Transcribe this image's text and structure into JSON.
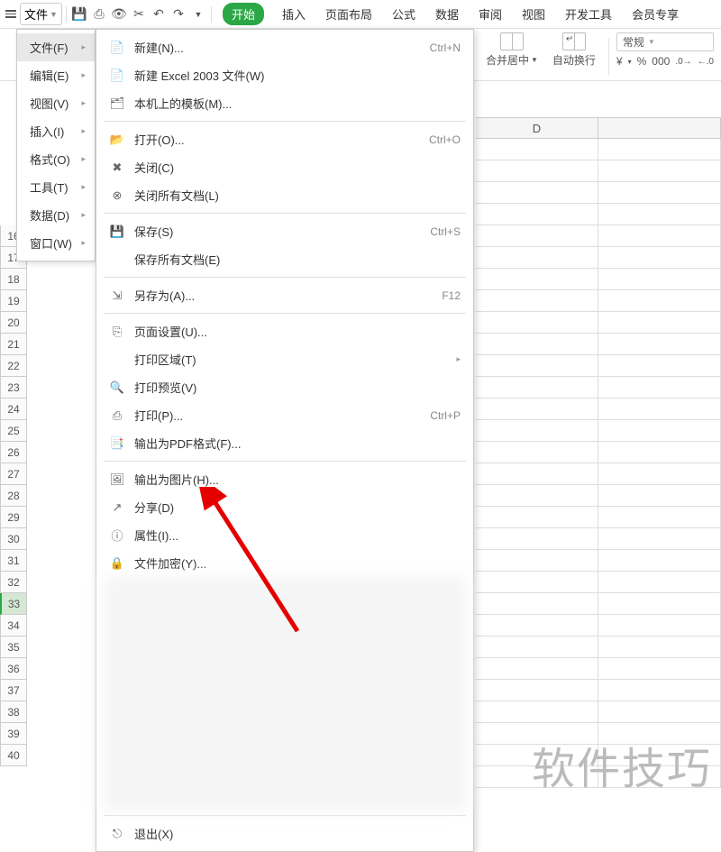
{
  "toolbar": {
    "file_label": "文件"
  },
  "tabs": [
    "开始",
    "插入",
    "页面布局",
    "公式",
    "数据",
    "审阅",
    "视图",
    "开发工具",
    "会员专享"
  ],
  "ribbon": {
    "merge_label": "合并居中",
    "wrap_label": "自动换行",
    "format_label": "常规",
    "currency": "¥",
    "percent": "%",
    "thousand": "000",
    "dec_inc": ".0→",
    "dec_dec": "←.0"
  },
  "menu_left": [
    {
      "label": "文件(F)",
      "hl": true
    },
    {
      "label": "编辑(E)"
    },
    {
      "label": "视图(V)"
    },
    {
      "label": "插入(I)"
    },
    {
      "label": "格式(O)"
    },
    {
      "label": "工具(T)"
    },
    {
      "label": "数据(D)"
    },
    {
      "label": "窗口(W)"
    }
  ],
  "submenu": [
    {
      "icon": "new",
      "label": "新建(N)...",
      "shortcut": "Ctrl+N"
    },
    {
      "icon": "new",
      "label": "新建 Excel 2003 文件(W)"
    },
    {
      "icon": "template",
      "label": "本机上的模板(M)..."
    },
    {
      "sep": true
    },
    {
      "icon": "open",
      "label": "打开(O)...",
      "shortcut": "Ctrl+O"
    },
    {
      "icon": "close",
      "label": "关闭(C)"
    },
    {
      "icon": "closeall",
      "label": "关闭所有文档(L)"
    },
    {
      "sep": true
    },
    {
      "icon": "save",
      "label": "保存(S)",
      "shortcut": "Ctrl+S"
    },
    {
      "icon": "",
      "label": "保存所有文档(E)"
    },
    {
      "sep": true
    },
    {
      "icon": "saveas",
      "label": "另存为(A)...",
      "shortcut": "F12"
    },
    {
      "sep": true
    },
    {
      "icon": "page",
      "label": "页面设置(U)..."
    },
    {
      "icon": "",
      "label": "打印区域(T)",
      "arrow": true
    },
    {
      "icon": "preview",
      "label": "打印预览(V)"
    },
    {
      "icon": "print",
      "label": "打印(P)...",
      "shortcut": "Ctrl+P"
    },
    {
      "icon": "pdf",
      "label": "输出为PDF格式(F)..."
    },
    {
      "sep": true
    },
    {
      "icon": "image",
      "label": "输出为图片(H)..."
    },
    {
      "icon": "share",
      "label": "分享(D)"
    },
    {
      "icon": "props",
      "label": "属性(I)..."
    },
    {
      "icon": "encrypt",
      "label": "文件加密(Y)..."
    },
    {
      "blur": true
    },
    {
      "sep": true
    },
    {
      "icon": "exit",
      "label": "退出(X)"
    }
  ],
  "columns": [
    "D"
  ],
  "rows": [
    16,
    17,
    18,
    19,
    20,
    21,
    22,
    23,
    24,
    25,
    26,
    27,
    28,
    29,
    30,
    31,
    32,
    33,
    34,
    35,
    36,
    37,
    38,
    39,
    40
  ],
  "selected_row": 33,
  "watermark": "软件技巧"
}
